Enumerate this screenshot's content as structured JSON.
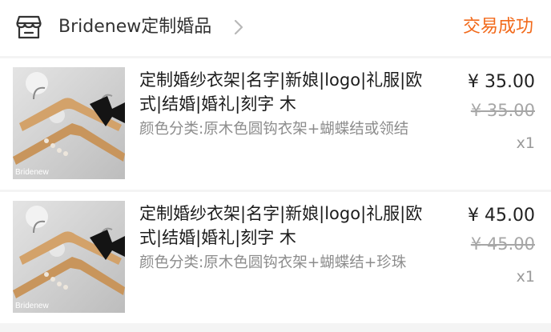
{
  "header": {
    "store_icon": "store-icon",
    "store_name": "Bridenew定制婚品",
    "chevron_icon": "chevron-right-icon",
    "status": "交易成功",
    "status_color": "#f26a1b"
  },
  "items": [
    {
      "image_icon": "hanger-bowtie-photo",
      "image_watermark": "Bridenew",
      "title": "定制婚纱衣架|名字|新娘|logo|礼服|欧式|结婚|婚礼|刻字 木",
      "sku": "颜色分类:原木色圆钩衣架+蝴蝶结或领结",
      "price": "¥ 35.00",
      "original_price": "¥ 35.00",
      "quantity": "x1"
    },
    {
      "image_icon": "hanger-bowtie-photo",
      "image_watermark": "Bridenew",
      "title": "定制婚纱衣架|名字|新娘|logo|礼服|欧式|结婚|婚礼|刻字 木",
      "sku": "颜色分类:原木色圆钩衣架+蝴蝶结+珍珠",
      "price": "¥ 45.00",
      "original_price": "¥ 45.00",
      "quantity": "x1"
    }
  ]
}
